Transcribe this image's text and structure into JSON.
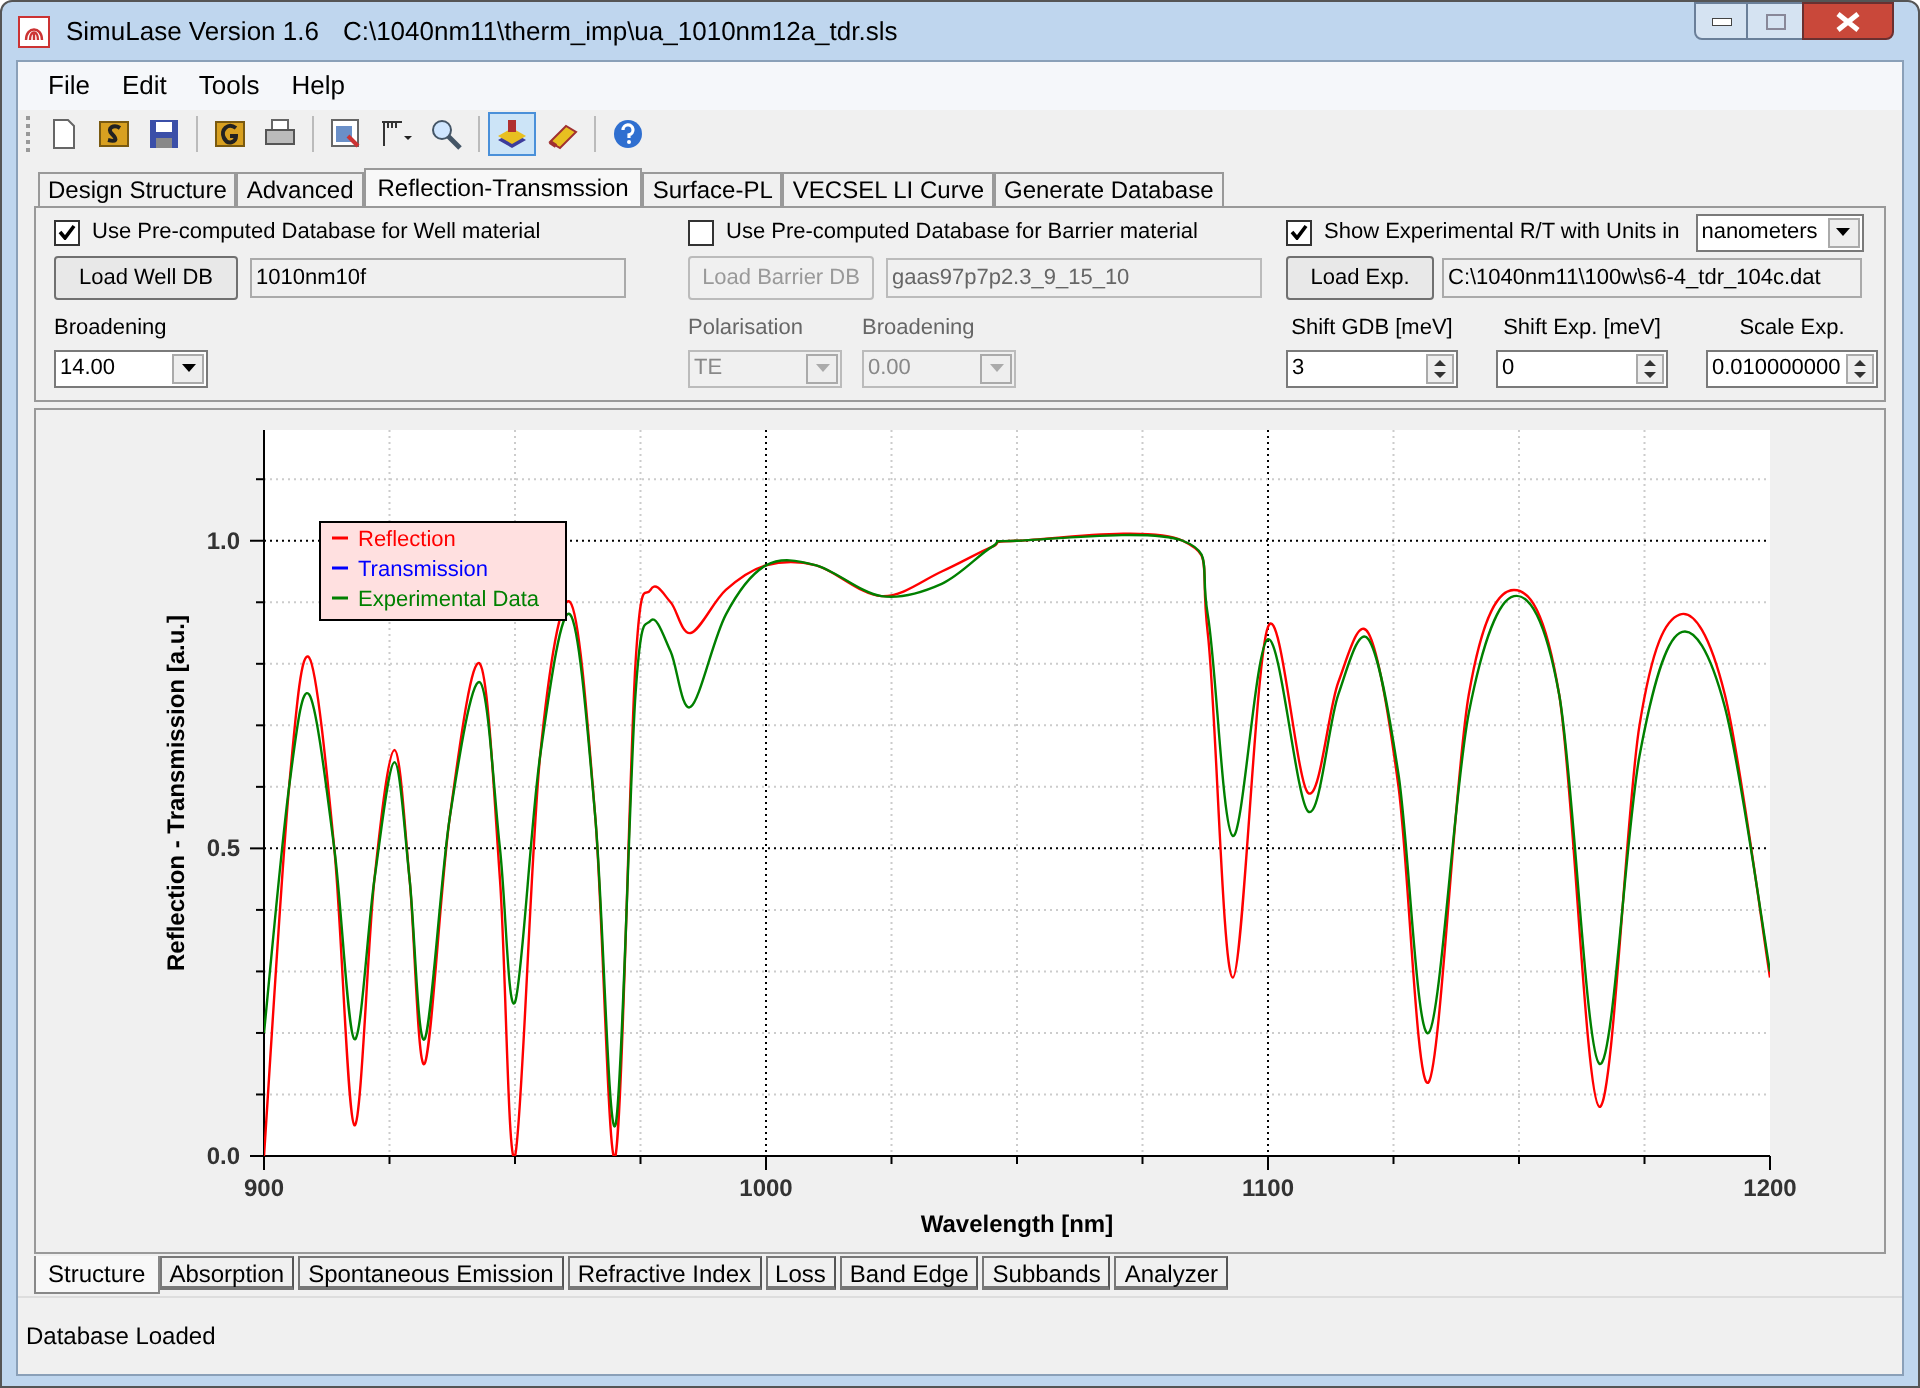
{
  "window": {
    "title": "SimuLase Version 1.6",
    "file_path": "C:\\1040nm11\\therm_imp\\ua_1010nm12a_tdr.sls"
  },
  "menu": [
    "File",
    "Edit",
    "Tools",
    "Help"
  ],
  "toolbar": [
    [
      {
        "pressed": false
      },
      {
        "pressed": false
      },
      {
        "pressed": false
      }
    ],
    [
      {
        "pressed": false
      },
      {
        "pressed": false
      }
    ],
    [
      {
        "pressed": false
      },
      {
        "pressed": false
      },
      {
        "pressed": false
      }
    ],
    [
      {
        "pressed": true
      },
      {
        "pressed": false
      }
    ],
    [
      {
        "pressed": false
      }
    ]
  ],
  "tabs": [
    {
      "label": "Design Structure",
      "selected": false
    },
    {
      "label": "Advanced",
      "selected": false
    },
    {
      "label": "Reflection-Transmssion",
      "selected": true
    },
    {
      "label": "Surface-PL",
      "selected": false
    },
    {
      "label": "VECSEL LI Curve",
      "selected": false
    },
    {
      "label": "Generate Database",
      "selected": false
    }
  ],
  "well": {
    "checkbox": {
      "label": "Use Pre-computed Database for Well material",
      "checked": true
    },
    "load_button": "Load Well DB",
    "file": "1010nm10f",
    "broadening": {
      "label": "Broadening",
      "value": "14.00"
    }
  },
  "barrier": {
    "checkbox": {
      "label": "Use Pre-computed Database for Barrier material",
      "checked": false
    },
    "load_button": "Load Barrier DB",
    "file": "gaas97p7p2.3_9_15_10",
    "disabled": true,
    "polarisation": {
      "label": "Polarisation",
      "value": "TE"
    },
    "broadening": {
      "label": "Broadening",
      "value": "0.00"
    }
  },
  "experiment": {
    "checkbox": {
      "label": "Show Experimental R/T with Units in",
      "checked": true
    },
    "units": "nanometers",
    "load_button": "Load Exp.",
    "file": "C:\\1040nm11\\100w\\s6-4_tdr_104c.dat",
    "spinners": [
      {
        "label": "Shift GDB [meV]",
        "value": "3"
      },
      {
        "label": "Shift Exp. [meV]",
        "value": "0"
      },
      {
        "label": "Scale Exp.",
        "value": "0.010000000"
      }
    ]
  },
  "chart_data": {
    "type": "line",
    "xlabel": "Wavelength [nm]",
    "ylabel": "Reflection - Transmission [a.u.]",
    "xlim": [
      900,
      1200
    ],
    "ylim": [
      0,
      1.18
    ],
    "xticks": [
      900,
      1000,
      1100,
      1200
    ],
    "yticks": [
      {
        "value": 0,
        "label": "0.0"
      },
      {
        "value": 0.5,
        "label": "0.5"
      },
      {
        "value": 1,
        "label": "1.0"
      }
    ],
    "grid": true,
    "legend": true,
    "x": [
      900,
      905,
      909,
      914,
      918,
      922,
      926,
      929,
      932,
      937,
      943,
      947,
      950,
      955,
      961,
      966,
      970,
      974,
      977,
      981,
      985,
      992,
      1000,
      1010,
      1023,
      1035,
      1045,
      1050,
      1083,
      1088,
      1093,
      1100,
      1108,
      1114,
      1120,
      1126,
      1132,
      1140,
      1149,
      1158,
      1166,
      1174,
      1182,
      1191,
      1200
    ],
    "series": [
      {
        "name": "Reflection",
        "color": "#ff0000",
        "values": [
          0.0,
          0.6,
          0.81,
          0.5,
          0.05,
          0.45,
          0.66,
          0.45,
          0.15,
          0.55,
          0.8,
          0.45,
          0.0,
          0.65,
          0.9,
          0.55,
          0.0,
          0.8,
          0.92,
          0.9,
          0.85,
          0.92,
          0.96,
          0.96,
          0.91,
          0.95,
          0.99,
          1.0,
          1.0,
          0.85,
          0.29,
          0.86,
          0.59,
          0.77,
          0.85,
          0.6,
          0.12,
          0.75,
          0.92,
          0.75,
          0.08,
          0.7,
          0.88,
          0.75,
          0.29
        ]
      },
      {
        "name": "Transmission",
        "color": "#0000ff",
        "values": [
          null,
          null,
          null,
          null,
          null,
          null,
          null,
          null,
          null,
          null,
          null,
          null,
          null,
          null,
          null,
          null,
          null,
          null,
          null,
          null,
          null,
          null,
          null,
          null,
          null,
          null,
          null,
          null,
          null,
          null,
          null,
          null,
          null,
          null,
          null,
          null,
          null,
          null,
          null,
          null,
          null,
          null,
          null,
          null,
          null
        ]
      },
      {
        "name": "Experimental Data",
        "color": "#008000",
        "values": [
          0.2,
          0.6,
          0.75,
          0.5,
          0.19,
          0.45,
          0.64,
          0.45,
          0.19,
          0.55,
          0.77,
          0.5,
          0.25,
          0.65,
          0.88,
          0.55,
          0.05,
          0.75,
          0.87,
          0.82,
          0.73,
          0.88,
          0.96,
          0.96,
          0.91,
          0.93,
          0.99,
          1.0,
          1.0,
          0.88,
          0.52,
          0.84,
          0.56,
          0.75,
          0.84,
          0.62,
          0.2,
          0.72,
          0.91,
          0.75,
          0.15,
          0.65,
          0.85,
          0.73,
          0.3
        ]
      }
    ]
  },
  "bottom_tabs": [
    {
      "label": "Structure",
      "selected": true
    },
    {
      "label": "Absorption",
      "selected": false
    },
    {
      "label": "Spontaneous Emission",
      "selected": false
    },
    {
      "label": "Refractive Index",
      "selected": false
    },
    {
      "label": "Loss",
      "selected": false
    },
    {
      "label": "Band Edge",
      "selected": false
    },
    {
      "label": "Subbands",
      "selected": false
    },
    {
      "label": "Analyzer",
      "selected": false
    }
  ],
  "status_bar": "Database Loaded"
}
